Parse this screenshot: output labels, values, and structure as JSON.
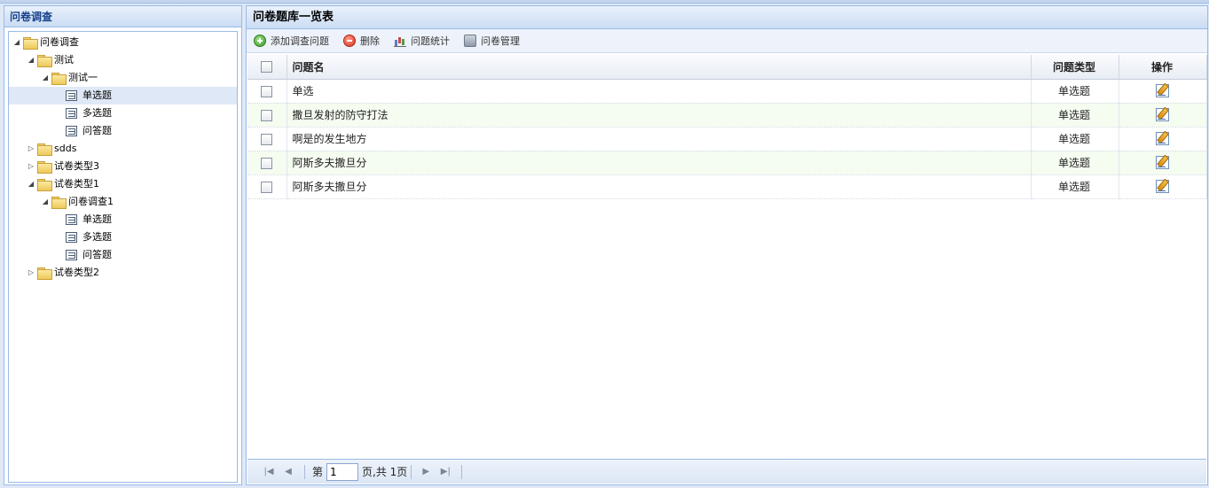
{
  "left_panel": {
    "title": "问卷调查",
    "tree": [
      {
        "label": "问卷调查",
        "level": 0,
        "type": "folder",
        "expanded": true
      },
      {
        "label": "测试",
        "level": 1,
        "type": "folder",
        "expanded": true
      },
      {
        "label": "测试一",
        "level": 2,
        "type": "folder",
        "expanded": true
      },
      {
        "label": "单选题",
        "level": 3,
        "type": "leaf",
        "selected": true
      },
      {
        "label": "多选题",
        "level": 3,
        "type": "leaf"
      },
      {
        "label": "问答题",
        "level": 3,
        "type": "leaf"
      },
      {
        "label": "sdds",
        "level": 1,
        "type": "folder",
        "expanded": false
      },
      {
        "label": "试卷类型3",
        "level": 1,
        "type": "folder",
        "expanded": false
      },
      {
        "label": "试卷类型1",
        "level": 1,
        "type": "folder",
        "expanded": true
      },
      {
        "label": "问卷调查1",
        "level": 2,
        "type": "folder",
        "expanded": true
      },
      {
        "label": "单选题",
        "level": 3,
        "type": "leaf"
      },
      {
        "label": "多选题",
        "level": 3,
        "type": "leaf"
      },
      {
        "label": "问答题",
        "level": 3,
        "type": "leaf"
      },
      {
        "label": "试卷类型2",
        "level": 1,
        "type": "folder",
        "expanded": false
      }
    ]
  },
  "right_panel": {
    "title": "问卷题库一览表",
    "toolbar": {
      "add_label": "添加调查问题",
      "delete_label": "删除",
      "stats_label": "问题统计",
      "manage_label": "问卷管理"
    },
    "table": {
      "headers": {
        "name": "问题名",
        "type": "问题类型",
        "action": "操作"
      },
      "rows": [
        {
          "name": "单选",
          "type": "单选题"
        },
        {
          "name": "撒旦发射的防守打法",
          "type": "单选题"
        },
        {
          "name": "啊是的发生地方",
          "type": "单选题"
        },
        {
          "name": "阿斯多夫撒旦分",
          "type": "单选题"
        },
        {
          "name": "阿斯多夫撒旦分",
          "type": "单选题"
        }
      ]
    },
    "pager": {
      "prefix": "第",
      "page_value": "1",
      "suffix": "页,共 1页"
    }
  }
}
